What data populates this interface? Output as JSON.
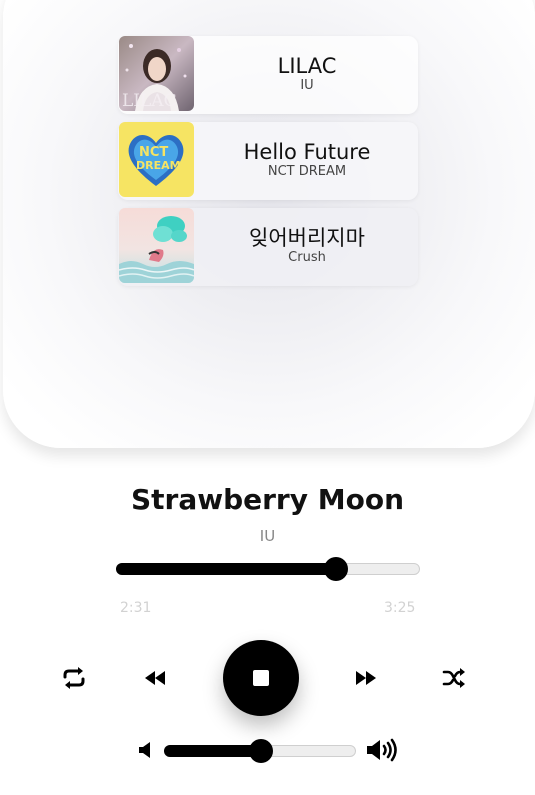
{
  "queue": [
    {
      "title": "LILAC",
      "artist": "IU",
      "cover_icon": "lilac-album-cover"
    },
    {
      "title": "Hello Future",
      "artist": "NCT DREAM",
      "cover_icon": "hello-future-album-cover"
    },
    {
      "title": "잊어버리지마",
      "artist": "Crush",
      "cover_icon": "crush-album-cover"
    }
  ],
  "now_playing": {
    "title": "Strawberry Moon",
    "artist": "IU",
    "current_time": "2:31",
    "total_time": "3:25",
    "progress": 0.72
  },
  "controls": {
    "repeat_icon": "repeat-icon",
    "previous_icon": "rewind-icon",
    "play_state_icon": "stop-icon",
    "next_icon": "fast-forward-icon",
    "shuffle_icon": "shuffle-icon"
  },
  "volume": {
    "level": 0.5,
    "low_icon": "volume-low-icon",
    "high_icon": "volume-high-icon"
  },
  "colors": {
    "accent": "#000000",
    "track_empty": "#eeeeee",
    "time_text": "#d2d2d2",
    "artist_text": "#888888"
  }
}
